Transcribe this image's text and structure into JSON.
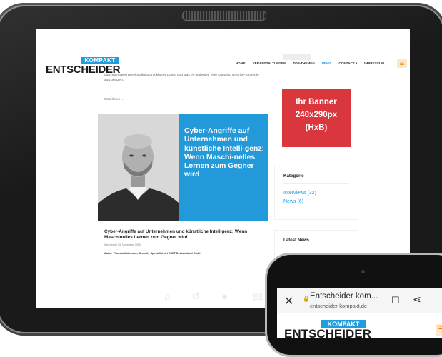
{
  "site": {
    "logo_badge": "KOMPAKT",
    "logo_text": "ENTSCHEIDER",
    "nav": [
      "HOME",
      "VERANSTALTUNGEN",
      "TOP-THEMEN",
      "NEWS",
      "CONTACT ▾",
      "IMPRESSUM"
    ],
    "active_nav": "NEWS",
    "menu_icon": "hamburger-icon"
  },
  "article_prev": {
    "text": "durchgängigen Bereitstellung druckbarer Daten und was es bedeutet, eine Digital Enterprise-Strategie aufzusetzen.",
    "read_more": "Weiterlesen ..."
  },
  "article": {
    "image_caption": "Cyber-Angriffe auf Unternehmen und künstliche Intelli-genz: Wenn Maschi-nelles Lernen zum Gegner wird",
    "title": "Cyber-Angriffe auf Unternehmen und künstliche Intelligenz: Wenn Maschinelles Lernen zum Gegner wird",
    "meta": "Interviews  /  05. November 2019",
    "author": "Autor: Thomas Uhlemann, Security Specialist bei ESET Deutschland GmbH"
  },
  "sidebar": {
    "banner_line1": "Ihr Banner",
    "banner_line2": "240x290px",
    "banner_line3": "(HxB)",
    "kategorie_heading": "Kategorie",
    "kategorie_links": [
      "Interviews (32)",
      "News (6)"
    ],
    "latest_heading": "Latest News"
  },
  "phone_browser": {
    "page_title": "Entscheider kom...",
    "url": "entscheider-kompakt.de",
    "logo_badge": "KOMPAKT",
    "logo_text": "ENTSCHEIDER"
  },
  "colors": {
    "accent_blue": "#1e9de0",
    "card_blue": "#2399d9",
    "banner_red": "#d9363e",
    "menu_orange": "#e68a00"
  }
}
